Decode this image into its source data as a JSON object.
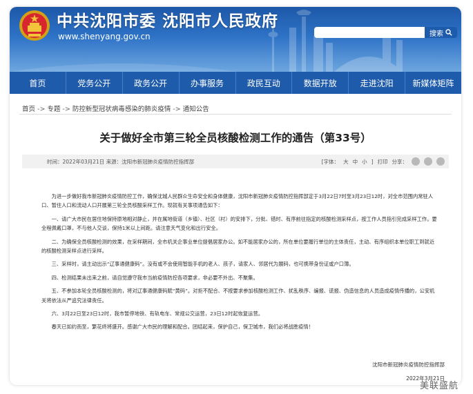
{
  "header": {
    "site_title": "中共沈阳市委  沈阳市人民政府",
    "site_url": "www.shenyang.gov.cn",
    "search_placeholder": "",
    "search_button": "搜索"
  },
  "nav": {
    "items": [
      "首页",
      "党务公开",
      "政务公开",
      "办事服务",
      "政民互动",
      "数据开放",
      "走进沈阳",
      "新媒体矩阵"
    ]
  },
  "breadcrumb": {
    "items": [
      "首页",
      "专题",
      "防控新型冠状病毒感染的肺炎疫情",
      "通知公告"
    ],
    "separator": "->"
  },
  "article": {
    "title": "关于做好全市第三轮全员核酸检测工作的通告（第33号）",
    "meta_time": "时间：2022年03月21日",
    "meta_source": "来源：沈阳市新冠肺炎疫情防控指挥部",
    "font_label": "[字体：",
    "font_large": "大",
    "font_medium": "中",
    "font_small": "小",
    "font_close": "]",
    "print_label": "打印",
    "share_label": "分享：",
    "paragraphs": [
      "为进一步做好我市新冠肺炎疫情防控工作，确保沈城人民群众生命安全和身体健康，沈阳市新冠肺炎疫情防控指挥部定于3月22日7时至3月23日12时，对全市范围内常驻人口、暂住人口和流动人口开展第三轮全员核酸采样工作。现就有关事项通告如下：",
      "一、请广大市民在居住地保持原地相对静止，并在属地街道（乡镇）、社区（村）的安排下，分批、错时、有序前往指定的核酸检测采样点，按工作人员指引完成采样工作。要全程佩戴口罩，不与他人交谈，保持1米以上间距。请注意天气变化和出行安全。",
      "二、为确保全员核酸检测的效果，在采样期间，全市机关企事业单位提倡居家办公。如不能居家办公的，所在单位要履行单位的主体责任，主动、有序组织本单位职工到就近的核酸检测采样点进行采样。",
      "三、采样时，请主动出示“辽事通健康码”。没有或不会使用智能手机的老人、孩子，请家人、邻居代为展码，也可携带身份证或户口簿。",
      "四、检测结果未出来之前，请自觉遵守我市当前疫情防控各项要求，非必要不外出、不聚集。",
      "五、不参加本轮全员核酸检测的，将对辽事通健康码赋“黄码”。对拒不配合、不按要求参加核酸检测工作、扰乱秩序、编报、谎报、伪造信息的人员造成疫情传播的，公安机关将依法从严追究法律责任。",
      "六、3月22日至23日12时，我市暂停地铁、有轨电车、常规公交运营，23日12时起恢复运营。",
      "春天已如约而至，繁花终将盛开。感谢广大市民的理解和配合。团结起来，保护自己，保卫城市，我们必将战胜疫情！"
    ],
    "signature_dept": "沈阳市新冠肺炎疫情防控指挥部",
    "signature_date": "2022年3月21日"
  },
  "watermark": "美联盛航",
  "colors": {
    "banner": "#2d72c6",
    "nav": "#1f5bab",
    "meta_bg": "#f1f1f1"
  }
}
